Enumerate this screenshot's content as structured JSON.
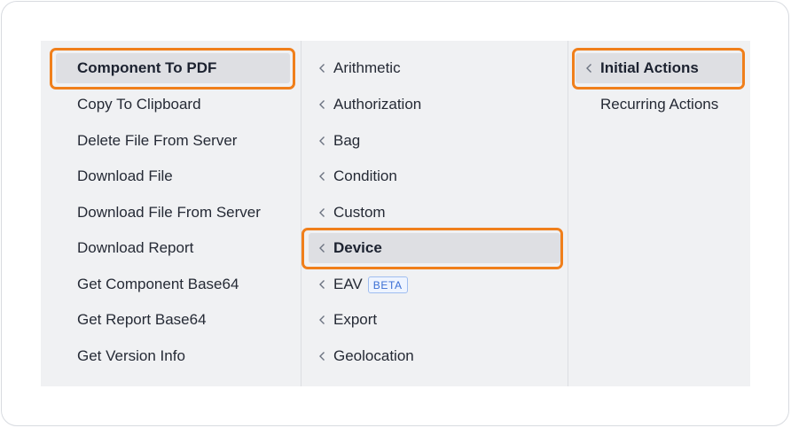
{
  "column1": {
    "items": [
      {
        "label": "Component To PDF",
        "selected": true
      },
      {
        "label": "Copy To Clipboard"
      },
      {
        "label": "Delete File From Server"
      },
      {
        "label": "Download File"
      },
      {
        "label": "Download File From Server"
      },
      {
        "label": "Download Report"
      },
      {
        "label": "Get Component Base64"
      },
      {
        "label": "Get Report Base64"
      },
      {
        "label": "Get Version Info"
      }
    ]
  },
  "column2": {
    "items": [
      {
        "label": "Arithmetic",
        "icon": "chevron-left-icon"
      },
      {
        "label": "Authorization",
        "icon": "chevron-left-icon"
      },
      {
        "label": "Bag",
        "icon": "chevron-left-icon"
      },
      {
        "label": "Condition",
        "icon": "chevron-left-icon"
      },
      {
        "label": "Custom",
        "icon": "chevron-left-icon"
      },
      {
        "label": "Device",
        "icon": "chevron-left-icon",
        "selected": true
      },
      {
        "label": "EAV",
        "icon": "chevron-left-icon",
        "badge": "BETA"
      },
      {
        "label": "Export",
        "icon": "chevron-left-icon"
      },
      {
        "label": "Geolocation",
        "icon": "chevron-left-icon"
      }
    ]
  },
  "column3": {
    "items": [
      {
        "label": "Initial Actions",
        "icon": "chevron-left-icon",
        "selected": true
      },
      {
        "label": "Recurring Actions"
      }
    ]
  },
  "colors": {
    "highlight": "#f07f1b",
    "selected_bg": "#dedfe3",
    "panel_bg": "#f0f1f3",
    "badge": "#3b6fd4"
  }
}
